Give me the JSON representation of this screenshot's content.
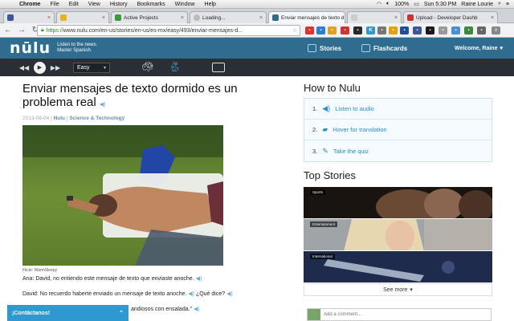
{
  "os_menubar": {
    "app": "Chrome",
    "menus": [
      "File",
      "Edit",
      "View",
      "History",
      "Bookmarks",
      "Window",
      "Help"
    ],
    "battery": "100%",
    "clock": "Sun 5:30 PM",
    "user": "Raine Lourie"
  },
  "browser": {
    "tabs": [
      {
        "label": ""
      },
      {
        "label": ""
      },
      {
        "label": "Active Projects"
      },
      {
        "label": "Loading..."
      },
      {
        "label": "Enviar mensajes de texto d"
      },
      {
        "label": ""
      },
      {
        "label": "Upload - Developer Dashb"
      }
    ],
    "url_protocol": "https://",
    "url_rest": "www.nulu.com/en-us/stories/en-us/es-mx/easy/493/enviar-mensajes-d..."
  },
  "header": {
    "logo": "nūlu",
    "tagline": "Listen to the news. Master Spanish.",
    "nav_stories": "Stories",
    "nav_flashcards": "Flashcards",
    "welcome": "Welcome, Raine"
  },
  "player": {
    "level": "Easy"
  },
  "article": {
    "title": "Enviar mensajes de texto dormido es un problema real",
    "date": "2013-08-04",
    "source": "Nulu",
    "category": "Science & Technology",
    "photo_credit": "Flickr: WarmSleepy",
    "lines": [
      "Ana: David, no entiendo este mensaje de texto que enviaste anoche.",
      "David: No recuerdo haberte enviado un mensaje de texto anoche.",
      "¿Qué dice?",
      "andiosos con ensalada.\""
    ]
  },
  "contact_bar": "¡Contáctanos!",
  "sidebar": {
    "howto_title": "How to Nulu",
    "howto": [
      {
        "num": "1.",
        "label": "Listen to audio"
      },
      {
        "num": "2.",
        "label": "Hover for translation"
      },
      {
        "num": "3.",
        "label": "Take the quiz"
      }
    ],
    "top_title": "Top Stories",
    "stories": [
      {
        "tag": "Sports"
      },
      {
        "tag": "Entertainment"
      },
      {
        "tag": "International"
      }
    ],
    "see_more": "See more",
    "comment_placeholder": "Add a comment..."
  }
}
